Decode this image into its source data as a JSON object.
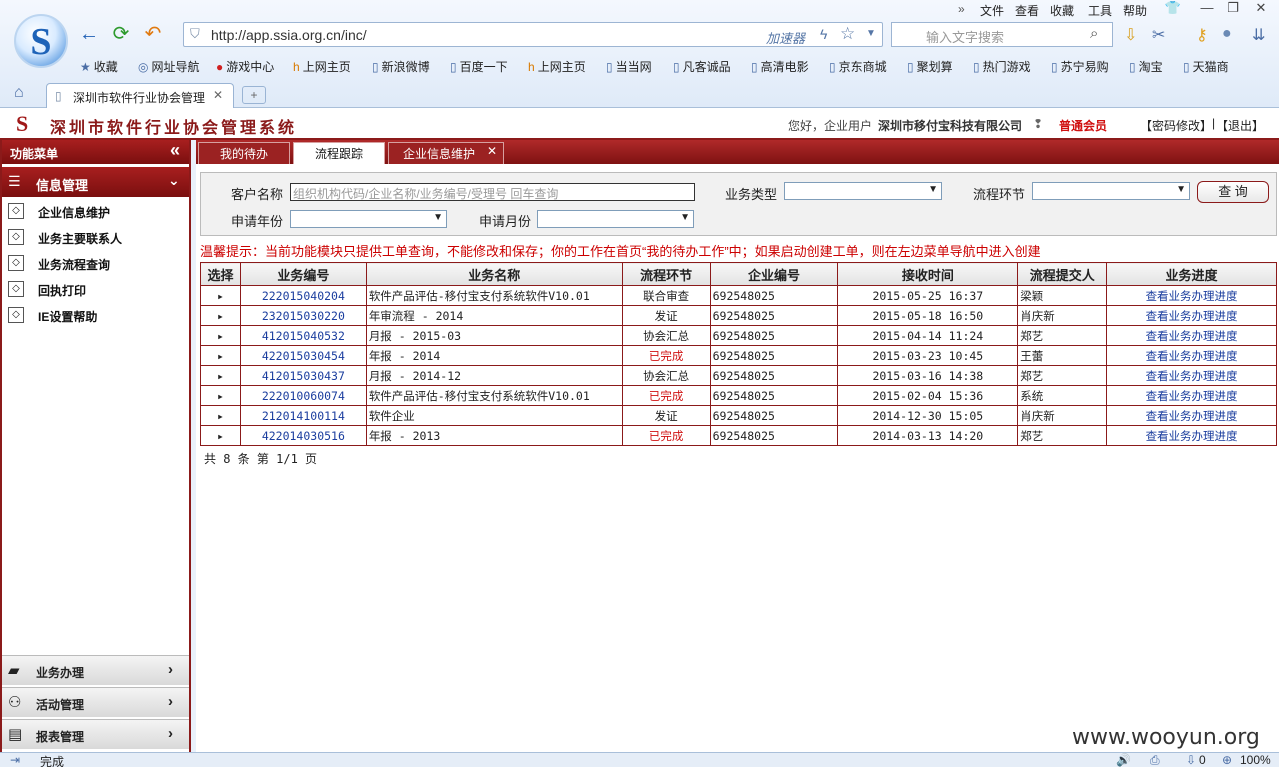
{
  "browser": {
    "menu": [
      "文件",
      "查看",
      "收藏",
      "工具",
      "帮助"
    ],
    "url": "http://app.ssia.org.cn/inc/",
    "accelerator": "加速器",
    "search_placeholder": "输入文字搜索",
    "favorites": [
      "收藏",
      "网址导航",
      "游戏中心",
      "上网主页",
      "新浪微博",
      "百度一下",
      "上网主页",
      "当当网",
      "凡客诚品",
      "高清电影",
      "京东商城",
      "聚划算",
      "热门游戏",
      "苏宁易购",
      "淘宝",
      "天猫商"
    ],
    "tab_title": "深圳市软件行业协会管理",
    "status": "完成",
    "zoom": "100%",
    "sound_count": "0"
  },
  "app": {
    "title": "深圳市软件行业协会管理系统",
    "greeting": "您好，企业用户",
    "company": "深圳市移付宝科技有限公司",
    "member": "普通会员",
    "pwd_change": "【密码修改】",
    "logout": "【退出】"
  },
  "sidebar": {
    "header": "功能菜单",
    "collapse_icon": "«",
    "section": "信息管理",
    "items": [
      "企业信息维护",
      "业务主要联系人",
      "业务流程查询",
      "回执打印",
      "IE设置帮助"
    ],
    "bottom": [
      "业务办理",
      "活动管理",
      "报表管理"
    ]
  },
  "tabs": [
    "我的待办",
    "流程跟踪",
    "企业信息维护"
  ],
  "filter": {
    "customer_label": "客户名称",
    "customer_placeholder": "组织机构代码/企业名称/业务编号/受理号 回车查询",
    "type_label": "业务类型",
    "step_label": "流程环节",
    "query_btn": "查 询",
    "year_label": "申请年份",
    "month_label": "申请月份"
  },
  "hint": "温馨提示：当前功能模块只提供工单查询，不能修改和保存；你的工作在首页“我的待办工作”中；如果启动创建工单，则在左边菜单导航中进入创建",
  "table": {
    "headers": [
      "选择",
      "业务编号",
      "业务名称",
      "流程环节",
      "企业编号",
      "接收时间",
      "流程提交人",
      "业务进度"
    ],
    "rows": [
      [
        "222015040204",
        "软件产品评估-移付宝支付系统软件V10.01",
        "联合审查",
        "692548025",
        "2015-05-25 16:37",
        "梁颖",
        "查看业务办理进度",
        false
      ],
      [
        "232015030220",
        "年审流程 - 2014",
        "发证",
        "692548025",
        "2015-05-18 16:50",
        "肖庆新",
        "查看业务办理进度",
        false
      ],
      [
        "412015040532",
        "月报 - 2015-03",
        "协会汇总",
        "692548025",
        "2015-04-14 11:24",
        "郑艺",
        "查看业务办理进度",
        false
      ],
      [
        "422015030454",
        "年报 - 2014",
        "已完成",
        "692548025",
        "2015-03-23 10:45",
        "王蕾",
        "查看业务办理进度",
        true
      ],
      [
        "412015030437",
        "月报 - 2014-12",
        "协会汇总",
        "692548025",
        "2015-03-16 14:38",
        "郑艺",
        "查看业务办理进度",
        false
      ],
      [
        "222010060074",
        "软件产品评估-移付宝支付系统软件V10.01",
        "已完成",
        "692548025",
        "2015-02-04 15:36",
        "系统",
        "查看业务办理进度",
        true
      ],
      [
        "212014100114",
        "软件企业",
        "发证",
        "692548025",
        "2014-12-30 15:05",
        "肖庆新",
        "查看业务办理进度",
        false
      ],
      [
        "422014030516",
        "年报 - 2013",
        "已完成",
        "692548025",
        "2014-03-13 14:20",
        "郑艺",
        "查看业务办理进度",
        true
      ]
    ]
  },
  "footer": "共 8 条 第 1/1 页",
  "watermark": "www.wooyun.org"
}
